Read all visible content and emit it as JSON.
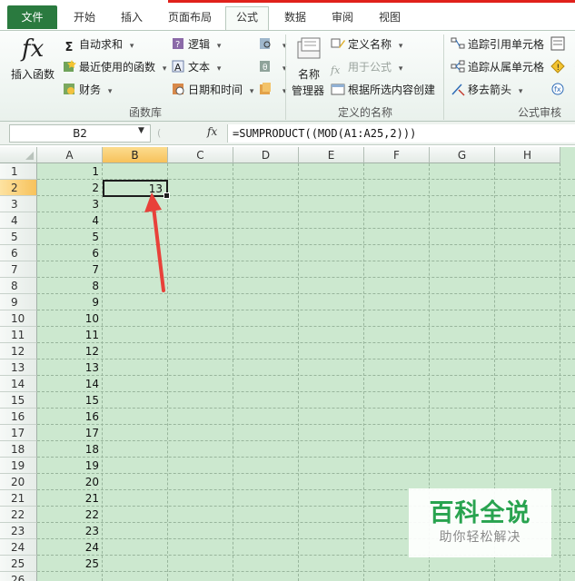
{
  "tabs": {
    "file": "文件",
    "home": "开始",
    "insert": "插入",
    "page_layout": "页面布局",
    "formulas": "公式",
    "data": "数据",
    "review": "审阅",
    "view": "视图"
  },
  "ribbon": {
    "insert_function": "插入函数",
    "autosum": "自动求和",
    "recently_used": "最近使用的函数",
    "financial": "财务",
    "logical": "逻辑",
    "text": "文本",
    "date_time": "日期和时间",
    "function_library": "函数库",
    "name_manager_line1": "名称",
    "name_manager_line2": "管理器",
    "define_name": "定义名称",
    "use_in_formula": "用于公式",
    "create_from_selection": "根据所选内容创建",
    "defined_names": "定义的名称",
    "trace_precedents": "追踪引用单元格",
    "trace_dependents": "追踪从属单元格",
    "remove_arrows": "移去箭头",
    "formula_auditing": "公式审核"
  },
  "formula_bar": {
    "name_box": "B2",
    "fx": "fx",
    "formula": "=SUMPRODUCT((MOD(A1:A25,2)))"
  },
  "sheet": {
    "columns": [
      "A",
      "B",
      "C",
      "D",
      "E",
      "F",
      "G",
      "H"
    ],
    "rows": [
      "1",
      "2",
      "3",
      "4",
      "5",
      "6",
      "7",
      "8",
      "9",
      "10",
      "11",
      "12",
      "13",
      "14",
      "15",
      "16",
      "17",
      "18",
      "19",
      "20",
      "21",
      "22",
      "23",
      "24",
      "25",
      "26"
    ],
    "col_a_values": [
      "1",
      "2",
      "3",
      "4",
      "5",
      "6",
      "7",
      "8",
      "9",
      "10",
      "11",
      "12",
      "13",
      "14",
      "15",
      "16",
      "17",
      "18",
      "19",
      "20",
      "21",
      "22",
      "23",
      "24",
      "25"
    ],
    "b2_value": "13"
  },
  "watermark": {
    "title": "百科全说",
    "subtitle": "助你轻松解决"
  },
  "colors": {
    "file_tab": "#2a7a3f",
    "grid_background": "#cce8cf",
    "selected_header": "#f7c25b",
    "arrow": "#e8413a",
    "watermark_green": "#28a34f"
  }
}
